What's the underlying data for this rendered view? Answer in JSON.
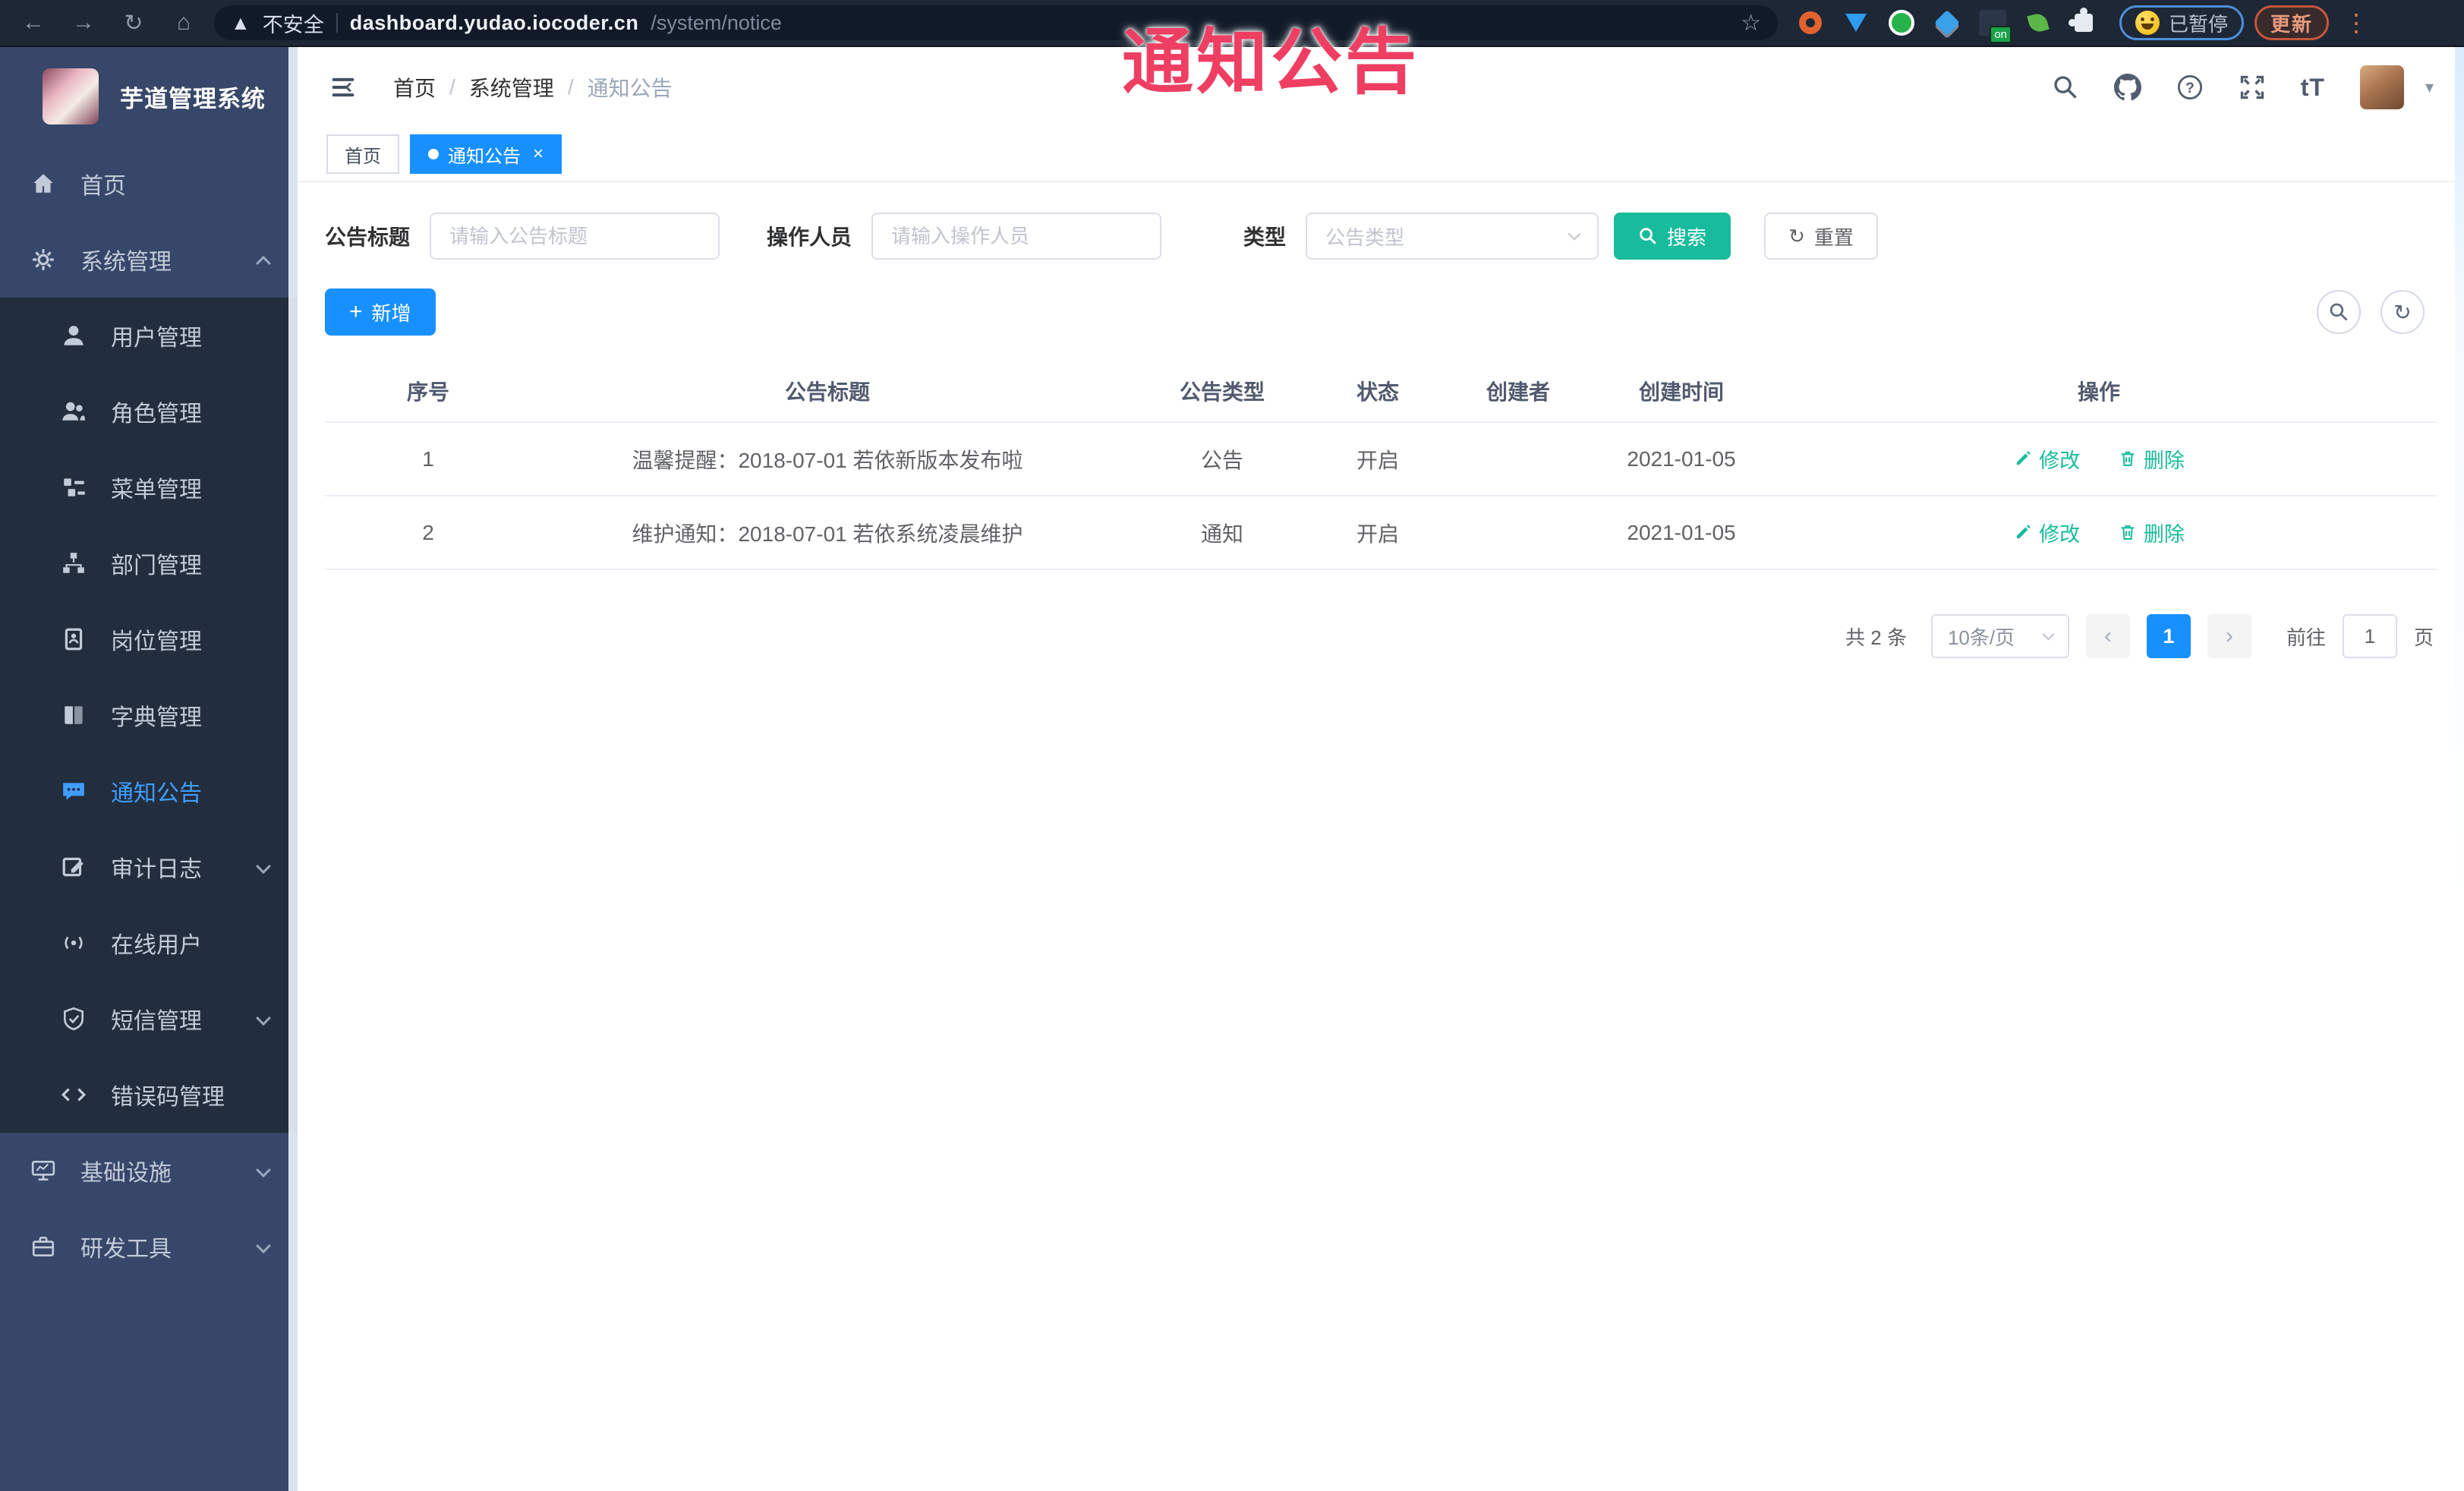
{
  "browser": {
    "security": "不安全",
    "host": "dashboard.yudao.iocoder.cn",
    "path": "/system/notice",
    "ext_badge": "on",
    "profile_status": "已暂停",
    "update_label": "更新"
  },
  "watermark": "通知公告",
  "sidebar": {
    "logo_title": "芋道管理系统",
    "home": "首页",
    "system": "系统管理",
    "sub": [
      "用户管理",
      "角色管理",
      "菜单管理",
      "部门管理",
      "岗位管理",
      "字典管理",
      "通知公告",
      "审计日志",
      "在线用户",
      "短信管理",
      "错误码管理"
    ],
    "infra": "基础设施",
    "dev": "研发工具"
  },
  "header": {
    "breadcrumb": [
      "首页",
      "系统管理",
      "通知公告"
    ],
    "sep": "/"
  },
  "tabs": {
    "home": "首页",
    "current": "通知公告"
  },
  "filters": {
    "title": {
      "label": "公告标题",
      "placeholder": "请输入公告标题"
    },
    "operator": {
      "label": "操作人员",
      "placeholder": "请输入操作人员"
    },
    "type": {
      "label": "类型",
      "placeholder": "公告类型"
    },
    "search_label": "搜索",
    "reset_label": "重置"
  },
  "toolbar": {
    "add_label": "新增"
  },
  "table": {
    "columns": [
      "序号",
      "公告标题",
      "公告类型",
      "状态",
      "创建者",
      "创建时间",
      "操作"
    ],
    "rows": [
      {
        "index": "1",
        "title": "温馨提醒：2018-07-01 若依新版本发布啦",
        "type": "公告",
        "status": "开启",
        "creator": "",
        "created": "2021-01-05"
      },
      {
        "index": "2",
        "title": "维护通知：2018-07-01 若依系统凌晨维护",
        "type": "通知",
        "status": "开启",
        "creator": "",
        "created": "2021-01-05"
      }
    ],
    "action_edit": "修改",
    "action_delete": "删除"
  },
  "pagination": {
    "total": "共 2 条",
    "page_size": "10条/页",
    "current_page": "1",
    "goto_label": "前往",
    "goto_value": "1",
    "unit": "页"
  },
  "colors": {
    "accent_blue": "#1890ff",
    "action_teal": "#18bc9c",
    "watermark_pink": "#ee3f63",
    "sidebar_bg": "#37476a",
    "submenu_bg": "#222d3d",
    "active_item_blue": "#3f9eff",
    "browser_bar_bg": "#1d2735"
  }
}
